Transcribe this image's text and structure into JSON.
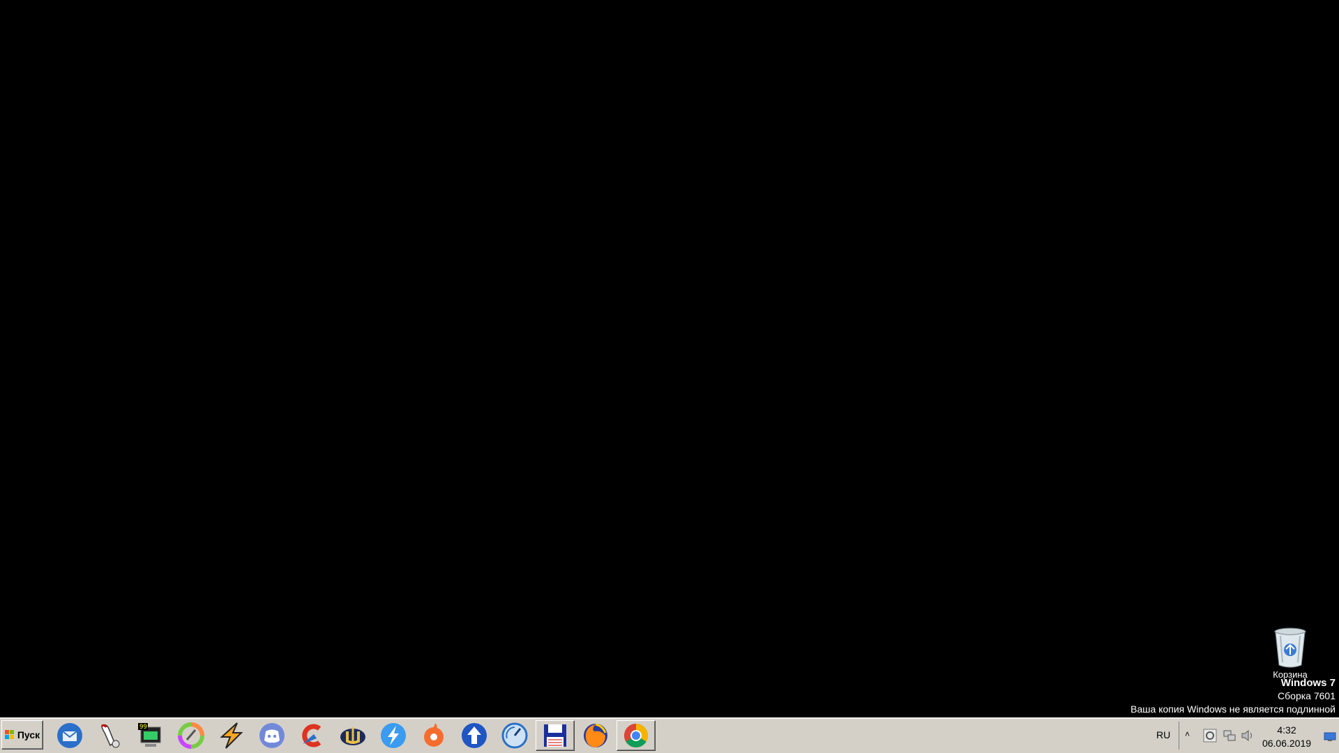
{
  "desktop": {
    "recycle_bin_label": "Корзина"
  },
  "watermark": {
    "title": "Windows 7",
    "build": "Сборка 7601",
    "notice": "Ваша копия Windows не является подлинной"
  },
  "taskbar": {
    "start_label": "Пуск",
    "apps": [
      {
        "icon": "thunderbird-icon"
      },
      {
        "icon": "macro-tool-icon"
      },
      {
        "icon": "system-monitor-icon"
      },
      {
        "icon": "color-picker-icon"
      },
      {
        "icon": "winamp-icon"
      },
      {
        "icon": "discord-icon"
      },
      {
        "icon": "ccleaner-icon"
      },
      {
        "icon": "unreal-tournament-icon"
      },
      {
        "icon": "lightning-app-icon"
      },
      {
        "icon": "origin-icon"
      },
      {
        "icon": "upload-arrow-icon"
      },
      {
        "icon": "speedometer-icon"
      },
      {
        "icon": "save-floppy-icon",
        "running": true
      },
      {
        "icon": "firefox-icon"
      },
      {
        "icon": "chrome-icon",
        "running": true
      }
    ],
    "language": "RU",
    "tray_expand": "˄",
    "clock_time": "4:32",
    "clock_date": "06.06.2019"
  }
}
